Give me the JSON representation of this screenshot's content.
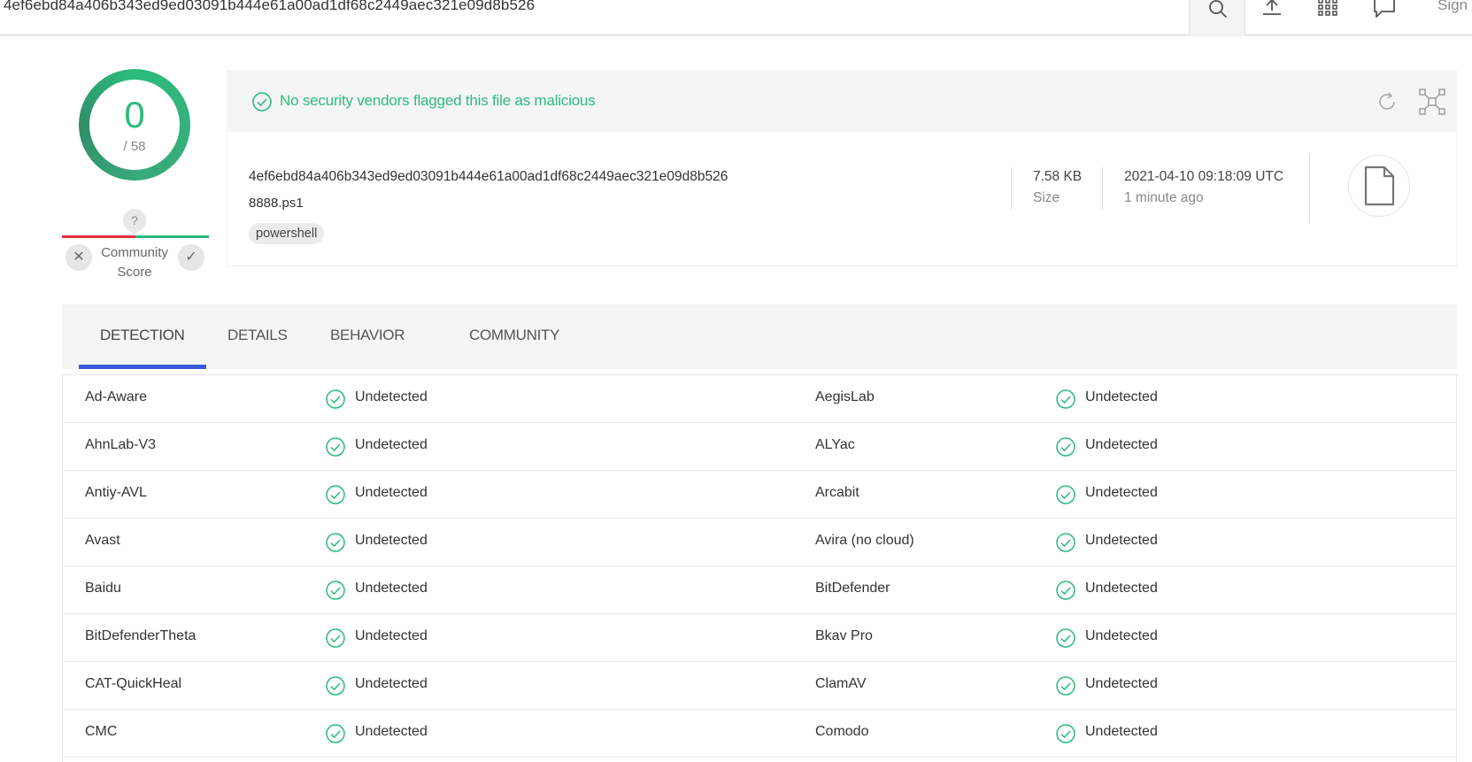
{
  "header": {
    "hash": "4ef6ebd84a406b343ed9ed03091b444e61a00ad1df68c2449aec321e09d8b526",
    "sign_label": "Sign"
  },
  "score": {
    "detections": "0",
    "total": "/ 58"
  },
  "community": {
    "question": "?",
    "label_line1": "Community",
    "label_line2": "Score",
    "downvote": "✕",
    "upvote": "✓"
  },
  "banner": {
    "message": "No security vendors flagged this file as malicious"
  },
  "file": {
    "hash": "4ef6ebd84a406b343ed9ed03091b444e61a00ad1df68c2449aec321e09d8b526",
    "name": "8888.ps1",
    "tag": "powershell",
    "size_value": "7.58 KB",
    "size_label": "Size",
    "date_value": "2021-04-10 09:18:09 UTC",
    "date_relative": "1 minute ago"
  },
  "tabs": [
    {
      "label": "DETECTION",
      "active": true
    },
    {
      "label": "DETAILS",
      "active": false
    },
    {
      "label": "BEHAVIOR",
      "active": false
    },
    {
      "label": "COMMUNITY",
      "active": false
    }
  ],
  "detections": [
    {
      "left": {
        "vendor": "Ad-Aware",
        "result": "Undetected"
      },
      "right": {
        "vendor": "AegisLab",
        "result": "Undetected"
      }
    },
    {
      "left": {
        "vendor": "AhnLab-V3",
        "result": "Undetected"
      },
      "right": {
        "vendor": "ALYac",
        "result": "Undetected"
      }
    },
    {
      "left": {
        "vendor": "Antiy-AVL",
        "result": "Undetected"
      },
      "right": {
        "vendor": "Arcabit",
        "result": "Undetected"
      }
    },
    {
      "left": {
        "vendor": "Avast",
        "result": "Undetected"
      },
      "right": {
        "vendor": "Avira (no cloud)",
        "result": "Undetected"
      }
    },
    {
      "left": {
        "vendor": "Baidu",
        "result": "Undetected"
      },
      "right": {
        "vendor": "BitDefender",
        "result": "Undetected"
      }
    },
    {
      "left": {
        "vendor": "BitDefenderTheta",
        "result": "Undetected"
      },
      "right": {
        "vendor": "Bkav Pro",
        "result": "Undetected"
      }
    },
    {
      "left": {
        "vendor": "CAT-QuickHeal",
        "result": "Undetected"
      },
      "right": {
        "vendor": "ClamAV",
        "result": "Undetected"
      }
    },
    {
      "left": {
        "vendor": "CMC",
        "result": "Undetected"
      },
      "right": {
        "vendor": "Comodo",
        "result": "Undetected"
      }
    }
  ],
  "colors": {
    "clean": "#2dbb7d",
    "malicious": "#e2313e",
    "tab_accent": "#3b5bdb"
  },
  "icons": {
    "search": "search-icon",
    "upload": "upload-icon",
    "apps": "grid-icon",
    "chat": "chat-icon",
    "check": "check-circle-icon",
    "refresh": "refresh-icon",
    "graph": "graph-icon",
    "file": "file-icon"
  }
}
